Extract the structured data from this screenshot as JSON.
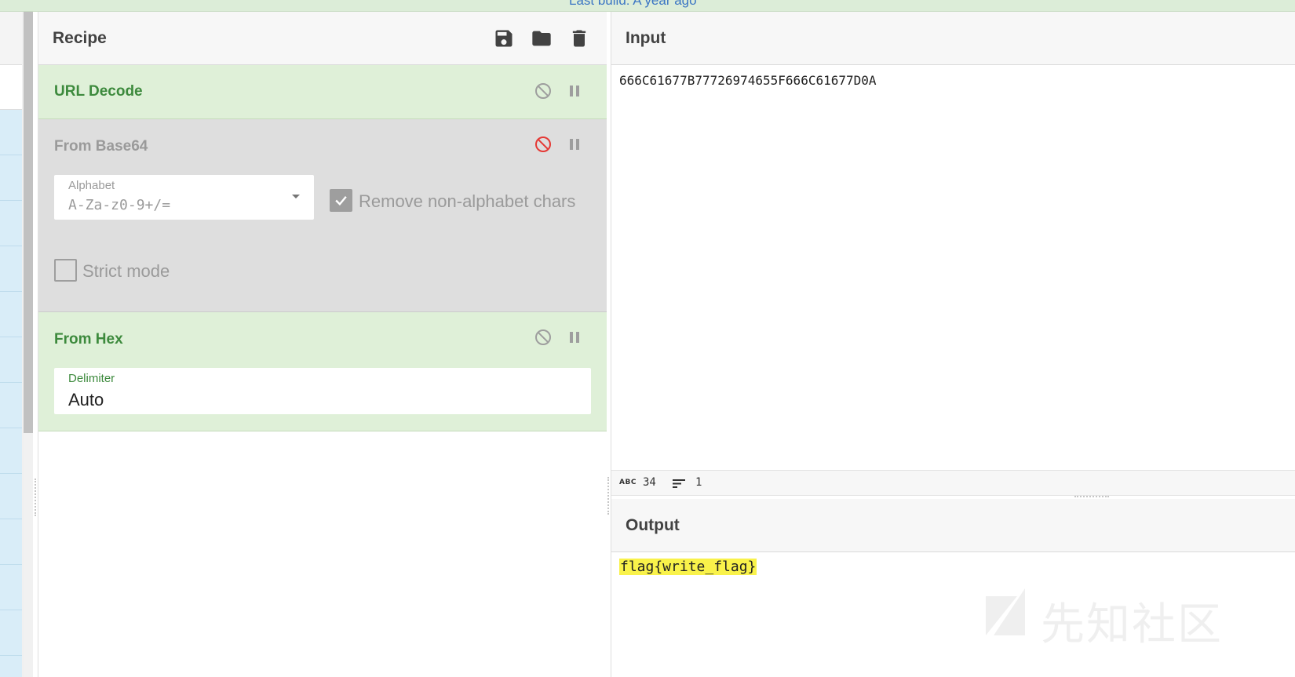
{
  "banner": {
    "text": "Last build: A year ago"
  },
  "recipe": {
    "title": "Recipe",
    "icons": [
      "save-icon",
      "folder-icon",
      "trash-icon"
    ],
    "operations": [
      {
        "name": "URL Decode",
        "state": "enabled"
      },
      {
        "name": "From Base64",
        "state": "disabled",
        "alphabet_label": "Alphabet",
        "alphabet_value": "A-Za-z0-9+/=",
        "remove_label": "Remove non-alphabet chars",
        "remove_checked": true,
        "strict_label": "Strict mode",
        "strict_checked": false
      },
      {
        "name": "From Hex",
        "state": "enabled",
        "delimiter_label": "Delimiter",
        "delimiter_value": "Auto"
      }
    ]
  },
  "input": {
    "title": "Input",
    "text": "666C61677B77726974655F666C61677D0A",
    "length": "34",
    "lines": "1",
    "length_icon_text": "ABC"
  },
  "output": {
    "title": "Output",
    "text": "flag{write_flag}"
  },
  "watermark": {
    "text": "先知社区"
  },
  "colors": {
    "enabled_bg": "#dff0d8",
    "enabled_text": "#3d8a3d",
    "disabled_bg": "#dedede",
    "disable_red": "#e53935",
    "highlight": "#f9f24a"
  }
}
